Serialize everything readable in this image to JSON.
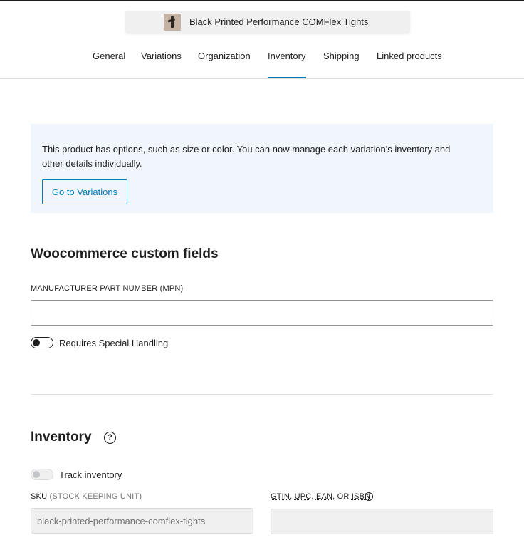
{
  "header": {
    "product_title": "Black Printed Performance COMFlex Tights",
    "thumbnail_icon": "product-thumbnail"
  },
  "tabs": [
    {
      "label": "General"
    },
    {
      "label": "Variations"
    },
    {
      "label": "Organization"
    },
    {
      "label": "Inventory",
      "active": true
    },
    {
      "label": "Shipping"
    },
    {
      "label": "Linked products"
    }
  ],
  "notice": {
    "text": "This product has options, such as size or color. You can now manage each variation's inventory and other details individually.",
    "button_label": "Go to Variations"
  },
  "custom_fields": {
    "title": "Woocommerce custom fields",
    "mpn_label": "MANUFACTURER PART NUMBER (MPN)",
    "mpn_value": "",
    "special_handling_label": "Requires Special Handling",
    "special_handling_on": false
  },
  "inventory": {
    "title": "Inventory",
    "help_icon": "?",
    "track_label": "Track inventory",
    "track_on": false,
    "sku_label_main": "SKU",
    "sku_label_sub": "(STOCK KEEPING UNIT)",
    "sku_value": "black-printed-performance-comflex-tights",
    "gtin_label": {
      "gtin": "GTIN",
      "upc": "UPC",
      "ean": "EAN",
      "or": "OR",
      "isbn": "ISBN"
    },
    "gtin_value": ""
  },
  "colors": {
    "accent": "#007cba",
    "notice_bg": "#f0f6fc"
  }
}
